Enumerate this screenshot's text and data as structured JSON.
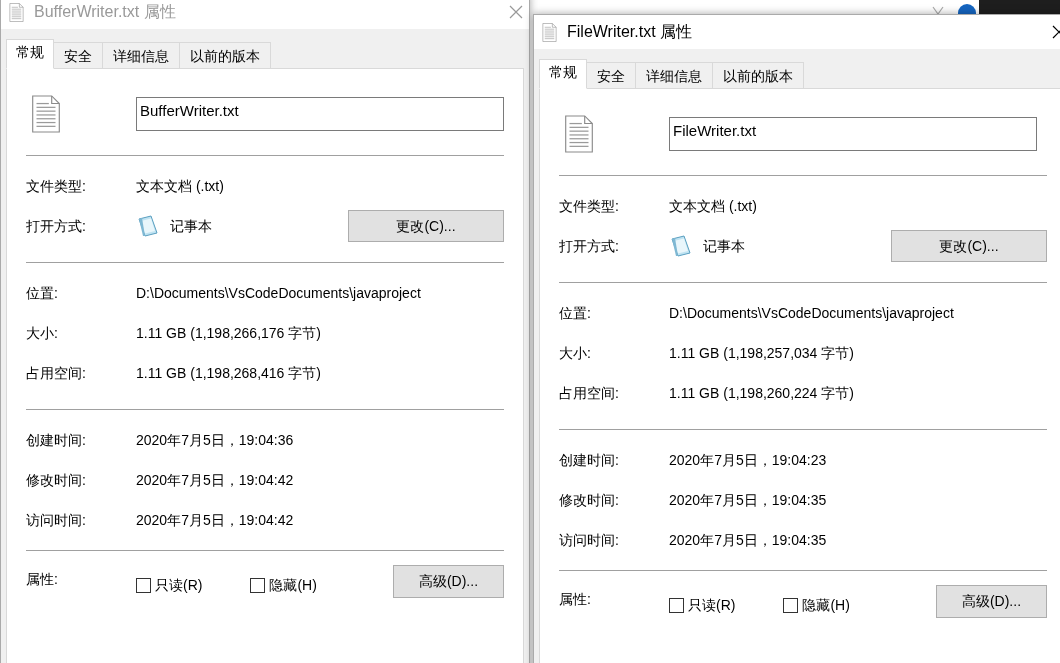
{
  "dialogs": [
    {
      "title": "BufferWriter.txt 属性",
      "active": false,
      "tabs": [
        {
          "label": "常规",
          "selected": true
        },
        {
          "label": "安全",
          "selected": false
        },
        {
          "label": "详细信息",
          "selected": false
        },
        {
          "label": "以前的版本",
          "selected": false
        }
      ],
      "file_name": "BufferWriter.txt",
      "groups": [
        [
          {
            "kind": "text",
            "label": "文件类型:",
            "value": "文本文档 (.txt)"
          },
          {
            "kind": "app",
            "label": "打开方式:",
            "value": "记事本",
            "button": "更改(C)..."
          }
        ],
        [
          {
            "kind": "text",
            "label": "位置:",
            "value": "D:\\Documents\\VsCodeDocuments\\javaproject"
          },
          {
            "kind": "text",
            "label": "大小:",
            "value": "1.11 GB (1,198,266,176 字节)"
          },
          {
            "kind": "text",
            "label": "占用空间:",
            "value": "1.11 GB (1,198,268,416 字节)"
          }
        ],
        [
          {
            "kind": "text",
            "label": "创建时间:",
            "value": "2020年7月5日，19:04:36"
          },
          {
            "kind": "text",
            "label": "修改时间:",
            "value": "2020年7月5日，19:04:42"
          },
          {
            "kind": "text",
            "label": "访问时间:",
            "value": "2020年7月5日，19:04:42"
          }
        ]
      ],
      "attributes": {
        "label": "属性:",
        "checkboxes": [
          {
            "label": "只读(R)",
            "checked": false
          },
          {
            "label": "隐藏(H)",
            "checked": false
          }
        ],
        "button": "高级(D)..."
      }
    },
    {
      "title": "FileWriter.txt 属性",
      "active": true,
      "tabs": [
        {
          "label": "常规",
          "selected": true
        },
        {
          "label": "安全",
          "selected": false
        },
        {
          "label": "详细信息",
          "selected": false
        },
        {
          "label": "以前的版本",
          "selected": false
        }
      ],
      "file_name": "FileWriter.txt",
      "groups": [
        [
          {
            "kind": "text",
            "label": "文件类型:",
            "value": "文本文档 (.txt)"
          },
          {
            "kind": "app",
            "label": "打开方式:",
            "value": "记事本",
            "button": "更改(C)..."
          }
        ],
        [
          {
            "kind": "text",
            "label": "位置:",
            "value": "D:\\Documents\\VsCodeDocuments\\javaproject"
          },
          {
            "kind": "text",
            "label": "大小:",
            "value": "1.11 GB (1,198,257,034 字节)"
          },
          {
            "kind": "text",
            "label": "占用空间:",
            "value": "1.11 GB (1,198,260,224 字节)"
          }
        ],
        [
          {
            "kind": "text",
            "label": "创建时间:",
            "value": "2020年7月5日，19:04:23"
          },
          {
            "kind": "text",
            "label": "修改时间:",
            "value": "2020年7月5日，19:04:35"
          },
          {
            "kind": "text",
            "label": "访问时间:",
            "value": "2020年7月5日，19:04:35"
          }
        ]
      ],
      "attributes": {
        "label": "属性:",
        "checkboxes": [
          {
            "label": "只读(R)",
            "checked": false
          },
          {
            "label": "隐藏(H)",
            "checked": false
          }
        ],
        "button": "高级(D)..."
      }
    }
  ]
}
